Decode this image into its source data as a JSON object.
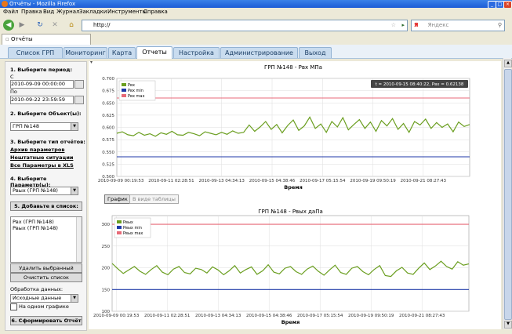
{
  "window": {
    "title": "Отчёты - Mozilla Firefox"
  },
  "menu": [
    "Файл",
    "Правка",
    "Вид",
    "Журнал",
    "Закладки",
    "Инструменты",
    "Справка"
  ],
  "address": {
    "url": "http://",
    "search_placeholder": "Яндекс"
  },
  "browser_tab": {
    "label": "Отчёты"
  },
  "app_tabs": [
    "Список ГРП",
    "Мониторинг",
    "Карта",
    "Отчеты",
    "Настройка",
    "Администрирование",
    "Выход"
  ],
  "sidebar": {
    "period_title": "1. Выберите период:",
    "from_label": "С",
    "from_value": "2010-09-09 00:00:00",
    "to_label": "По",
    "to_value": "2010-09-22 23:59:59",
    "object_title": "2. Выберите Объект(ы):",
    "object_value": "ГРП №148",
    "report_title": "3. Выберите тип отчётов:",
    "report_links": [
      "Архив параметров",
      "Нештатные ситуации",
      "Все Параметры в XLS"
    ],
    "param_title": "4. Выберите Параметр(ы):",
    "param_value": "Рвых (ГРП №148)",
    "add_button": "5. Добавьте в список:",
    "list_items": [
      "Рвх (ГРП №148)",
      "Рвых (ГРП №148)"
    ],
    "delete_button": "Удалить выбранный",
    "clear_button": "Очистить список",
    "processing_label": "Обработка данных:",
    "processing_value": "Исходные данные",
    "one_chart_label": "На одном графике",
    "build_button": "6. Сформировать Отчёт"
  },
  "view_buttons": {
    "chart": "График",
    "table": "В виде таблицы"
  },
  "tooltip": "t = 2010-09-15 08:40:22, Pвх = 0.62138",
  "chart_data": [
    {
      "type": "line",
      "title": "ГРП №148 - Pвх МПа",
      "xlabel": "Время",
      "ylim": [
        0.5,
        0.7
      ],
      "yticks": [
        "0.700",
        "0.675",
        "0.650",
        "0.625",
        "0.600",
        "0.575",
        "0.550",
        "0.525",
        "0.500"
      ],
      "xticks": [
        "2010-09-09 00:19:53",
        "2010-09-11 02:28:51",
        "2010-09-13 04:34:13",
        "2010-09-15 04:38:46",
        "2010-09-17 05:15:54",
        "2010-09-19 09:50:19",
        "2010-09-21 08:27:43"
      ],
      "legend": [
        "Pвх",
        "Pвх min",
        "Pвх max"
      ],
      "series": [
        {
          "name": "Pвх",
          "color": "#6a9e1f",
          "values": [
            0.588,
            0.591,
            0.585,
            0.583,
            0.59,
            0.584,
            0.587,
            0.582,
            0.589,
            0.586,
            0.592,
            0.585,
            0.584,
            0.59,
            0.587,
            0.583,
            0.591,
            0.588,
            0.585,
            0.59,
            0.586,
            0.593,
            0.588,
            0.59,
            0.605,
            0.592,
            0.601,
            0.612,
            0.596,
            0.606,
            0.589,
            0.604,
            0.615,
            0.594,
            0.603,
            0.621,
            0.598,
            0.607,
            0.59,
            0.612,
            0.601,
            0.62,
            0.595,
            0.606,
            0.616,
            0.598,
            0.611,
            0.592,
            0.614,
            0.603,
            0.618,
            0.596,
            0.608,
            0.59,
            0.612,
            0.605,
            0.617,
            0.598,
            0.61,
            0.6,
            0.607,
            0.591,
            0.611,
            0.602,
            0.606
          ]
        },
        {
          "name": "Pвх min",
          "color": "#1f3aa8",
          "values": [
            0.54,
            0.54
          ]
        },
        {
          "name": "Pвх max",
          "color": "#e86a78",
          "values": [
            0.66,
            0.66
          ]
        }
      ]
    },
    {
      "type": "line",
      "title": "ГРП №148 - Pвых даПа",
      "xlabel": "Время",
      "ylim": [
        100,
        320
      ],
      "yticks": [
        "300",
        "250",
        "200",
        "150",
        "100"
      ],
      "xticks": [
        "2010-09-09 00:19:53",
        "2010-09-11 02:28:51",
        "2010-09-13 04:34:13",
        "2010-09-15 04:38:46",
        "2010-09-17 05:15:54",
        "2010-09-19 09:50:19",
        "2010-09-21 08:27:43"
      ],
      "legend": [
        "Pвых",
        "Pвых min",
        "Pвых max"
      ],
      "series": [
        {
          "name": "Pвых",
          "color": "#6a9e1f",
          "values": [
            210,
            198,
            187,
            195,
            203,
            192,
            185,
            196,
            205,
            190,
            184,
            197,
            203,
            189,
            186,
            199,
            196,
            188,
            202,
            195,
            184,
            193,
            205,
            188,
            196,
            202,
            185,
            193,
            207,
            190,
            186,
            199,
            203,
            191,
            185,
            197,
            204,
            192,
            183,
            195,
            206,
            189,
            185,
            199,
            203,
            191,
            184,
            196,
            205,
            182,
            180,
            193,
            201,
            188,
            185,
            199,
            211,
            196,
            204,
            215,
            203,
            197,
            214,
            206,
            209
          ]
        },
        {
          "name": "Pвых min",
          "color": "#1f3aa8",
          "values": [
            150,
            150
          ]
        },
        {
          "name": "Pвых max",
          "color": "#e86a78",
          "values": [
            300,
            300
          ]
        }
      ]
    }
  ]
}
